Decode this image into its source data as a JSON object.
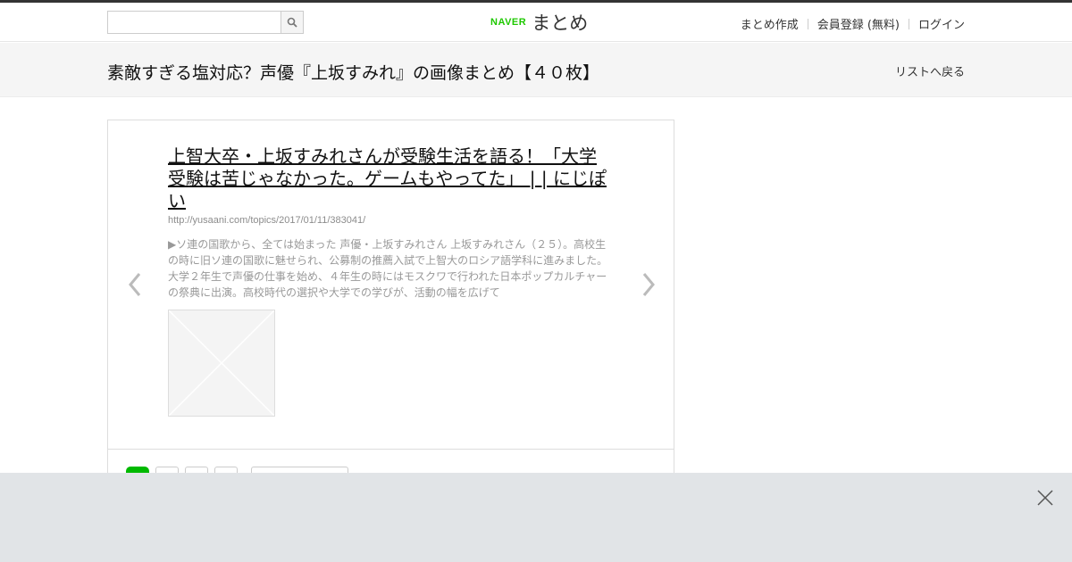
{
  "header": {
    "search": {
      "placeholder": "",
      "value": "",
      "button_icon": "search-icon"
    },
    "logo": {
      "brand": "NAVER",
      "product": "まとめ"
    },
    "nav": {
      "create": "まとめ作成",
      "register": "会員登録 (無料)",
      "login": "ログイン"
    }
  },
  "title_bar": {
    "title": "素敵すぎる塩対応？声優『上坂すみれ』の画像まとめ【４０枚】",
    "back_link": "リストへ戻る"
  },
  "card": {
    "link_title": "上智大卒・上坂すみれさんが受験生活を語る！「大学受験は苦じゃなかった。ゲームもやってた」 | | にじぽい",
    "url": "http://yusaani.com/topics/2017/01/11/383041/",
    "description": "▶ソ連の国歌から、全ては始まった 声優・上坂すみれさん 上坂すみれさん（２５）。高校生の時に旧ソ連の国歌に魅せられ、公募制の推薦入試で上智大のロシア語学科に進みました。大学２年生で声優の仕事を始め、４年生の時にはモスクワで行われた日本ポップカルチャーの祭典に出演。高校時代の選択や大学での学びが、活動の幅を広げて",
    "thumbnail_icon": "image-placeholder-icon",
    "prev_icon": "chevron-left-icon",
    "next_icon": "chevron-right-icon"
  },
  "share": {
    "line_color": "#00b900",
    "icons": [
      "line-icon",
      "share-icon",
      "share-icon",
      "share-icon",
      "share-icon"
    ]
  },
  "ad": {
    "close_icon": "close-icon",
    "background": "#e1e4e7"
  },
  "colors": {
    "brand_green": "#1ec800",
    "top_line": "#333333",
    "title_bar_bg": "#f5f5f5"
  }
}
